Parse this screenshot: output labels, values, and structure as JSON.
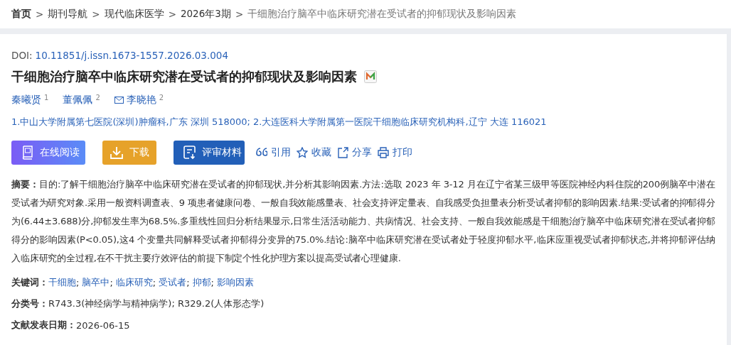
{
  "breadcrumb": [
    {
      "label": "首页",
      "current": false,
      "home": true
    },
    {
      "label": "期刊导航",
      "current": false,
      "home": false
    },
    {
      "label": "现代临床医学",
      "current": false,
      "home": false
    },
    {
      "label": "2026年3期",
      "current": false,
      "home": false
    },
    {
      "label": "干细胞治疗脑卒中临床研究潜在受试者的抑郁现状及影响因素",
      "current": true,
      "home": false
    }
  ],
  "breadcrumb_separator": ">",
  "doi": {
    "label": "DOI:",
    "value": "10.11851/j.issn.1673-1557.2026.03.004"
  },
  "title": "干细胞治疗脑卒中临床研究潜在受试者的抑郁现状及影响因素",
  "authors": [
    {
      "name": "秦曦贤",
      "affiliation": "1",
      "corresponding": false
    },
    {
      "name": "董佩佩",
      "affiliation": "2",
      "corresponding": false
    },
    {
      "name": "李晓艳",
      "affiliation": "2",
      "corresponding": true
    }
  ],
  "affiliations": "1.中山大学附属第七医院(深圳)肿瘤科,广东 深圳 518000; 2.大连医科大学附属第一医院干细胞临床研究机构科,辽宁 大连 116021",
  "buttons": [
    {
      "kind": "read",
      "label": "在线阅读"
    },
    {
      "kind": "download",
      "label": "下载"
    },
    {
      "kind": "review",
      "label": "评审材料"
    }
  ],
  "actions": [
    {
      "kind": "cite",
      "label": "引用"
    },
    {
      "kind": "favorite",
      "label": "收藏"
    },
    {
      "kind": "share",
      "label": "分享"
    },
    {
      "kind": "print",
      "label": "打印"
    }
  ],
  "abstract": {
    "label": "摘要：",
    "text": "目的:了解干细胞治疗脑卒中临床研究潜在受试者的抑郁现状,并分析其影响因素.方法:选取 2023 年 3-12 月在辽宁省某三级甲等医院神经内科住院的200例脑卒中潜在受试者为研究对象.采用一般资料调查表、9 项患者健康问卷、一般自我效能感量表、社会支持评定量表、自我感受负担量表分析受试者抑郁的影响因素.结果:受试者的抑郁得分为(6.44±3.688)分,抑郁发生率为68.5%.多重线性回归分析结果显示,日常生活活动能力、共病情况、社会支持、一般自我效能感是干细胞治疗脑卒中临床研究潜在受试者抑郁得分的影响因素(P<0.05),这4 个变量共同解释受试者抑郁得分变异的75.0%.结论:脑卒中临床研究潜在受试者处于轻度抑郁水平,临床应重视受试者抑郁状态,并将抑郁评估纳入临床研究的全过程,在不干扰主要疗效评估的前提下制定个性化护理方案以提高受试者心理健康."
  },
  "keywords": {
    "label": "关键词：",
    "separator": ";",
    "items": [
      "干细胞",
      "脑卒中",
      "临床研究",
      "受试者",
      "抑郁",
      "影响因素"
    ]
  },
  "classification": {
    "label": "分类号：",
    "value": "R743.3(神经病学与精神病学); R329.2(人体形态学)"
  },
  "publish_date": {
    "label": "文献发表日期：",
    "value": "2026-06-15"
  }
}
